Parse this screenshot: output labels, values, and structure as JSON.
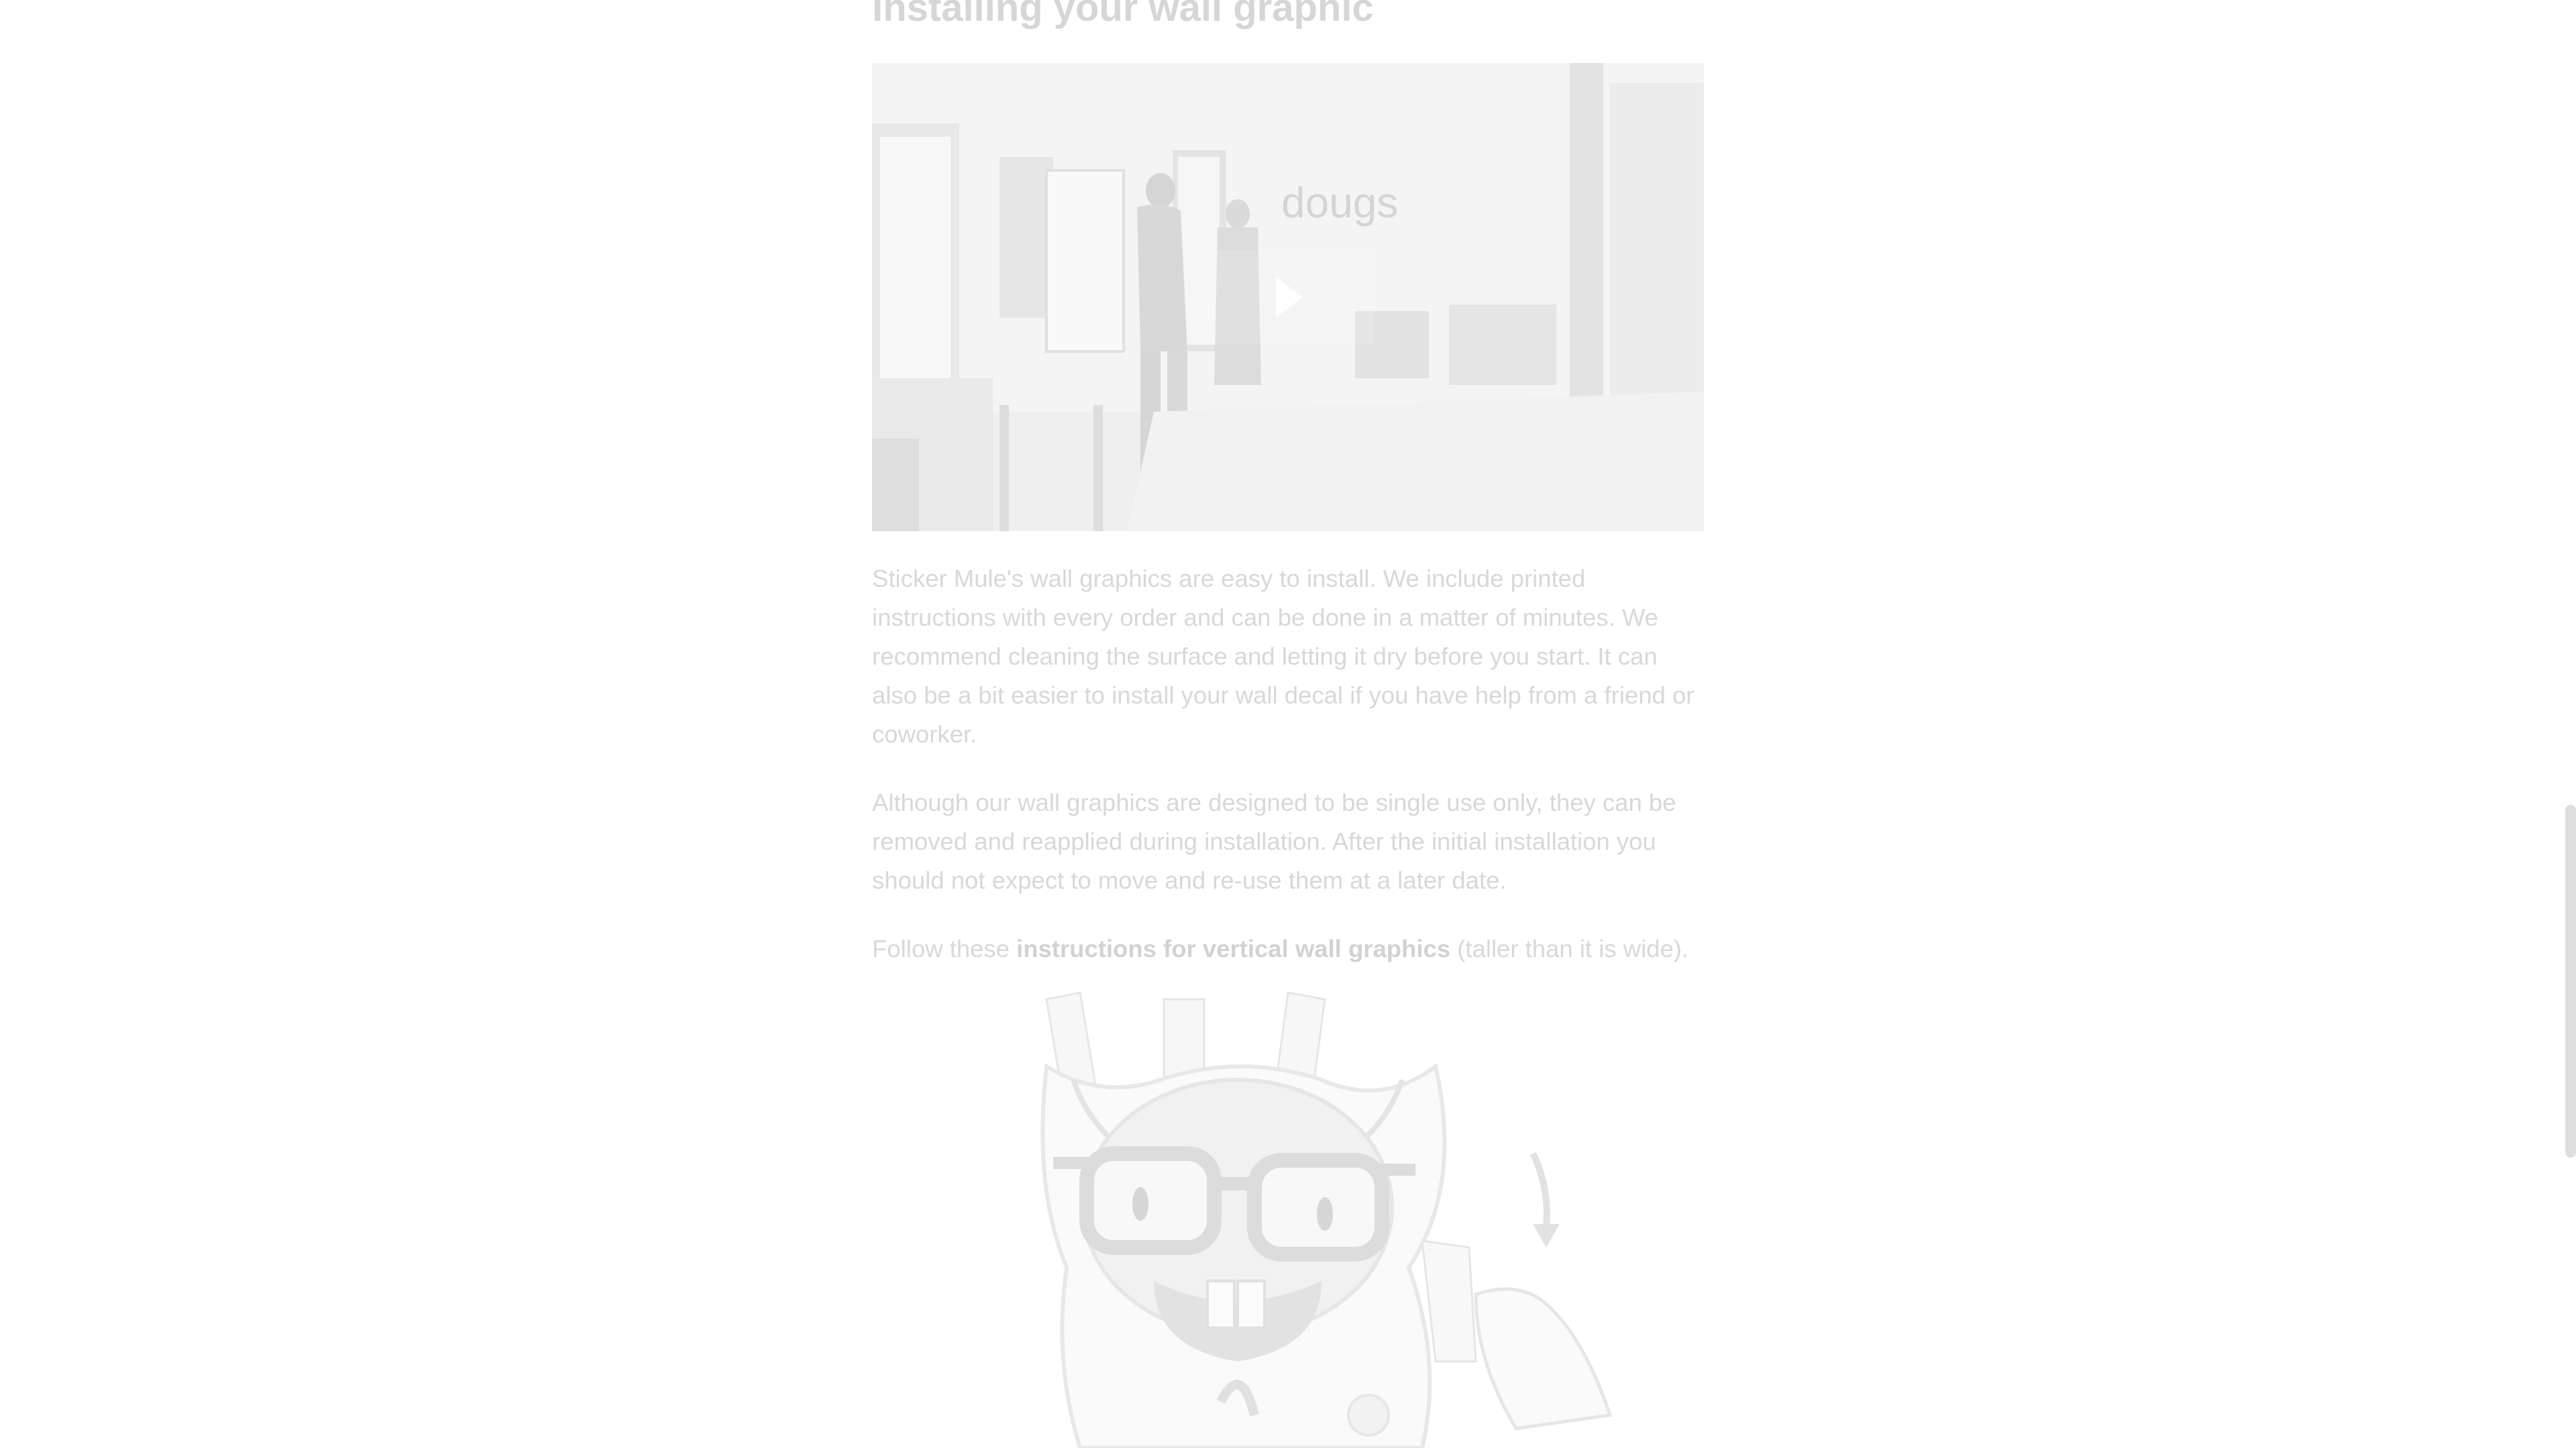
{
  "section": {
    "heading": "Installing your wall graphic"
  },
  "video": {
    "sign_text": "dougs",
    "play_label": "Play video"
  },
  "paragraphs": {
    "p1": "Sticker Mule's wall graphics are easy to install. We include printed instructions with every order and can be done in a matter of minutes. We recommend cleaning the surface and letting it dry before you start. It can also be a bit easier to install your wall decal if you have help from a friend or coworker.",
    "p2": "Although our wall graphics are designed to be single use only, they can be removed and reapplied during installation. After the initial installation you should not expect to move and re-use them at a later date.",
    "p3_prefix": "Follow these ",
    "p3_link": "instructions for vertical wall graphics",
    "p3_suffix": " (taller than it is wide)."
  },
  "colors": {
    "heading": "#d6d6d6",
    "body_text": "#d8d8d8",
    "video_bg": "#eeeeee"
  }
}
